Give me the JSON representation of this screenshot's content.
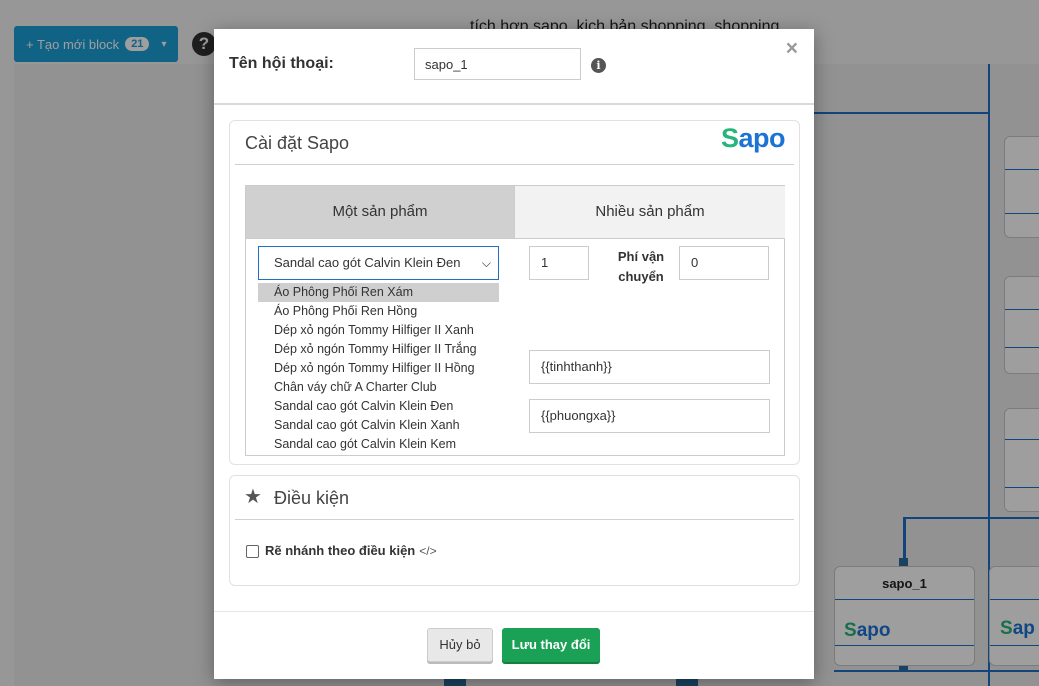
{
  "background": {
    "create_button": {
      "label": "+ Tạo mới block",
      "count": "21",
      "caret": "▾"
    },
    "help_icon": "?",
    "scenario_title": "tích hợp sapo, kịch bản shopping, shopping",
    "node": {
      "title": "sapo_1",
      "logo_s": "S",
      "logo_apo": "apo"
    },
    "node_right": {
      "logo_s": "S",
      "logo_apo": "ap"
    }
  },
  "modal": {
    "close": "×",
    "name_label": "Tên hội thoại:",
    "name_value": "sapo_1",
    "info_icon": "i",
    "sapo_panel": {
      "title": "Cài đặt Sapo",
      "logo_s": "S",
      "logo_apo": "apo",
      "tabs": [
        {
          "label": "Một sản phẩm"
        },
        {
          "label": "Nhiều sản phẩm"
        }
      ],
      "selected_product": "Sandal cao gót Calvin Klein Đen",
      "dropdown_options": [
        "Áo Phông Phối Ren Xám",
        "Áo Phông Phối Ren Hồng",
        "Dép xỏ ngón Tommy Hilfiger II Xanh",
        "Dép xỏ ngón Tommy Hilfiger II Trắng",
        "Dép xỏ ngón Tommy Hilfiger II Hồng",
        "Chân váy chữ A Charter Club",
        "Sandal cao gót Calvin Klein Đen",
        "Sandal cao gót Calvin Klein Xanh",
        "Sandal cao gót Calvin Klein Kem"
      ],
      "quantity": "1",
      "shipping_label_line1": "Phí vận",
      "shipping_label_line2": "chuyển",
      "shipping_fee": "0",
      "city_value": "{{tinhthanh}}",
      "ward_value": "{{phuongxa}}"
    },
    "condition_panel": {
      "title": "Điều kiện",
      "checkbox_label": "Rẽ nhánh theo điều kiện",
      "code_icon": "</>"
    },
    "footer": {
      "cancel_label": "Hủy bỏ",
      "save_label": "Lưu thay đổi"
    }
  }
}
